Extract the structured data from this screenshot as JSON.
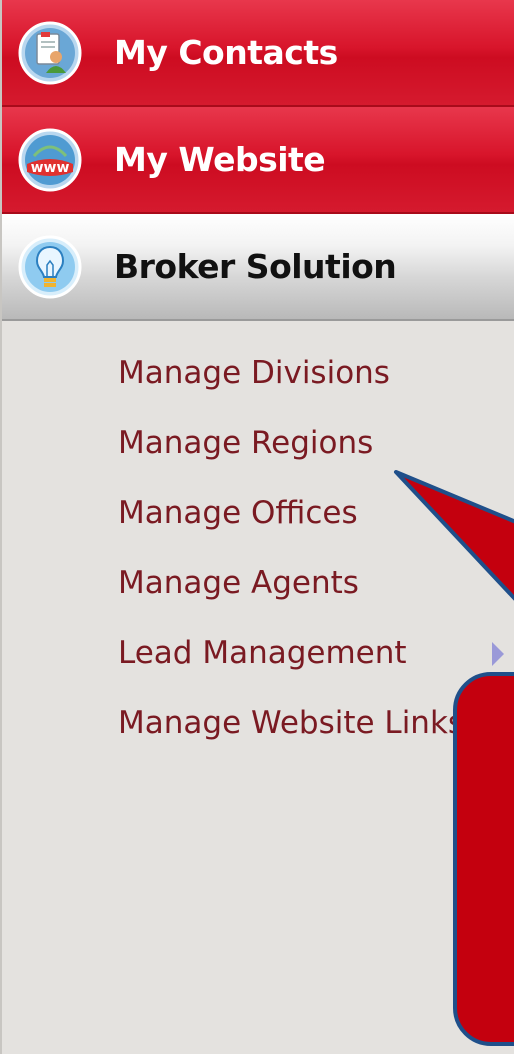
{
  "sidebar": {
    "headers": [
      {
        "label": "My Contacts",
        "icon": "contacts-icon",
        "state": "collapsed"
      },
      {
        "label": "My Website",
        "icon": "www-globe-icon",
        "state": "collapsed"
      },
      {
        "label": "Broker Solution",
        "icon": "lightbulb-icon",
        "state": "expanded"
      }
    ],
    "menu_items": [
      {
        "label": "Manage Divisions"
      },
      {
        "label": "Manage Regions"
      },
      {
        "label": "Manage Offices"
      },
      {
        "label": "Manage Agents"
      },
      {
        "label": "Lead Management",
        "has_submenu": true
      },
      {
        "label": "Manage Website Links"
      }
    ]
  },
  "colors": {
    "header_red": "#d8152b",
    "header_active": "#d7d7d7",
    "menu_bg": "#e4e2df",
    "menu_text": "#7a1a22",
    "callout_fill": "#c4000e",
    "callout_border": "#1f4f8a",
    "submenu_arrow": "#9a99d8"
  }
}
